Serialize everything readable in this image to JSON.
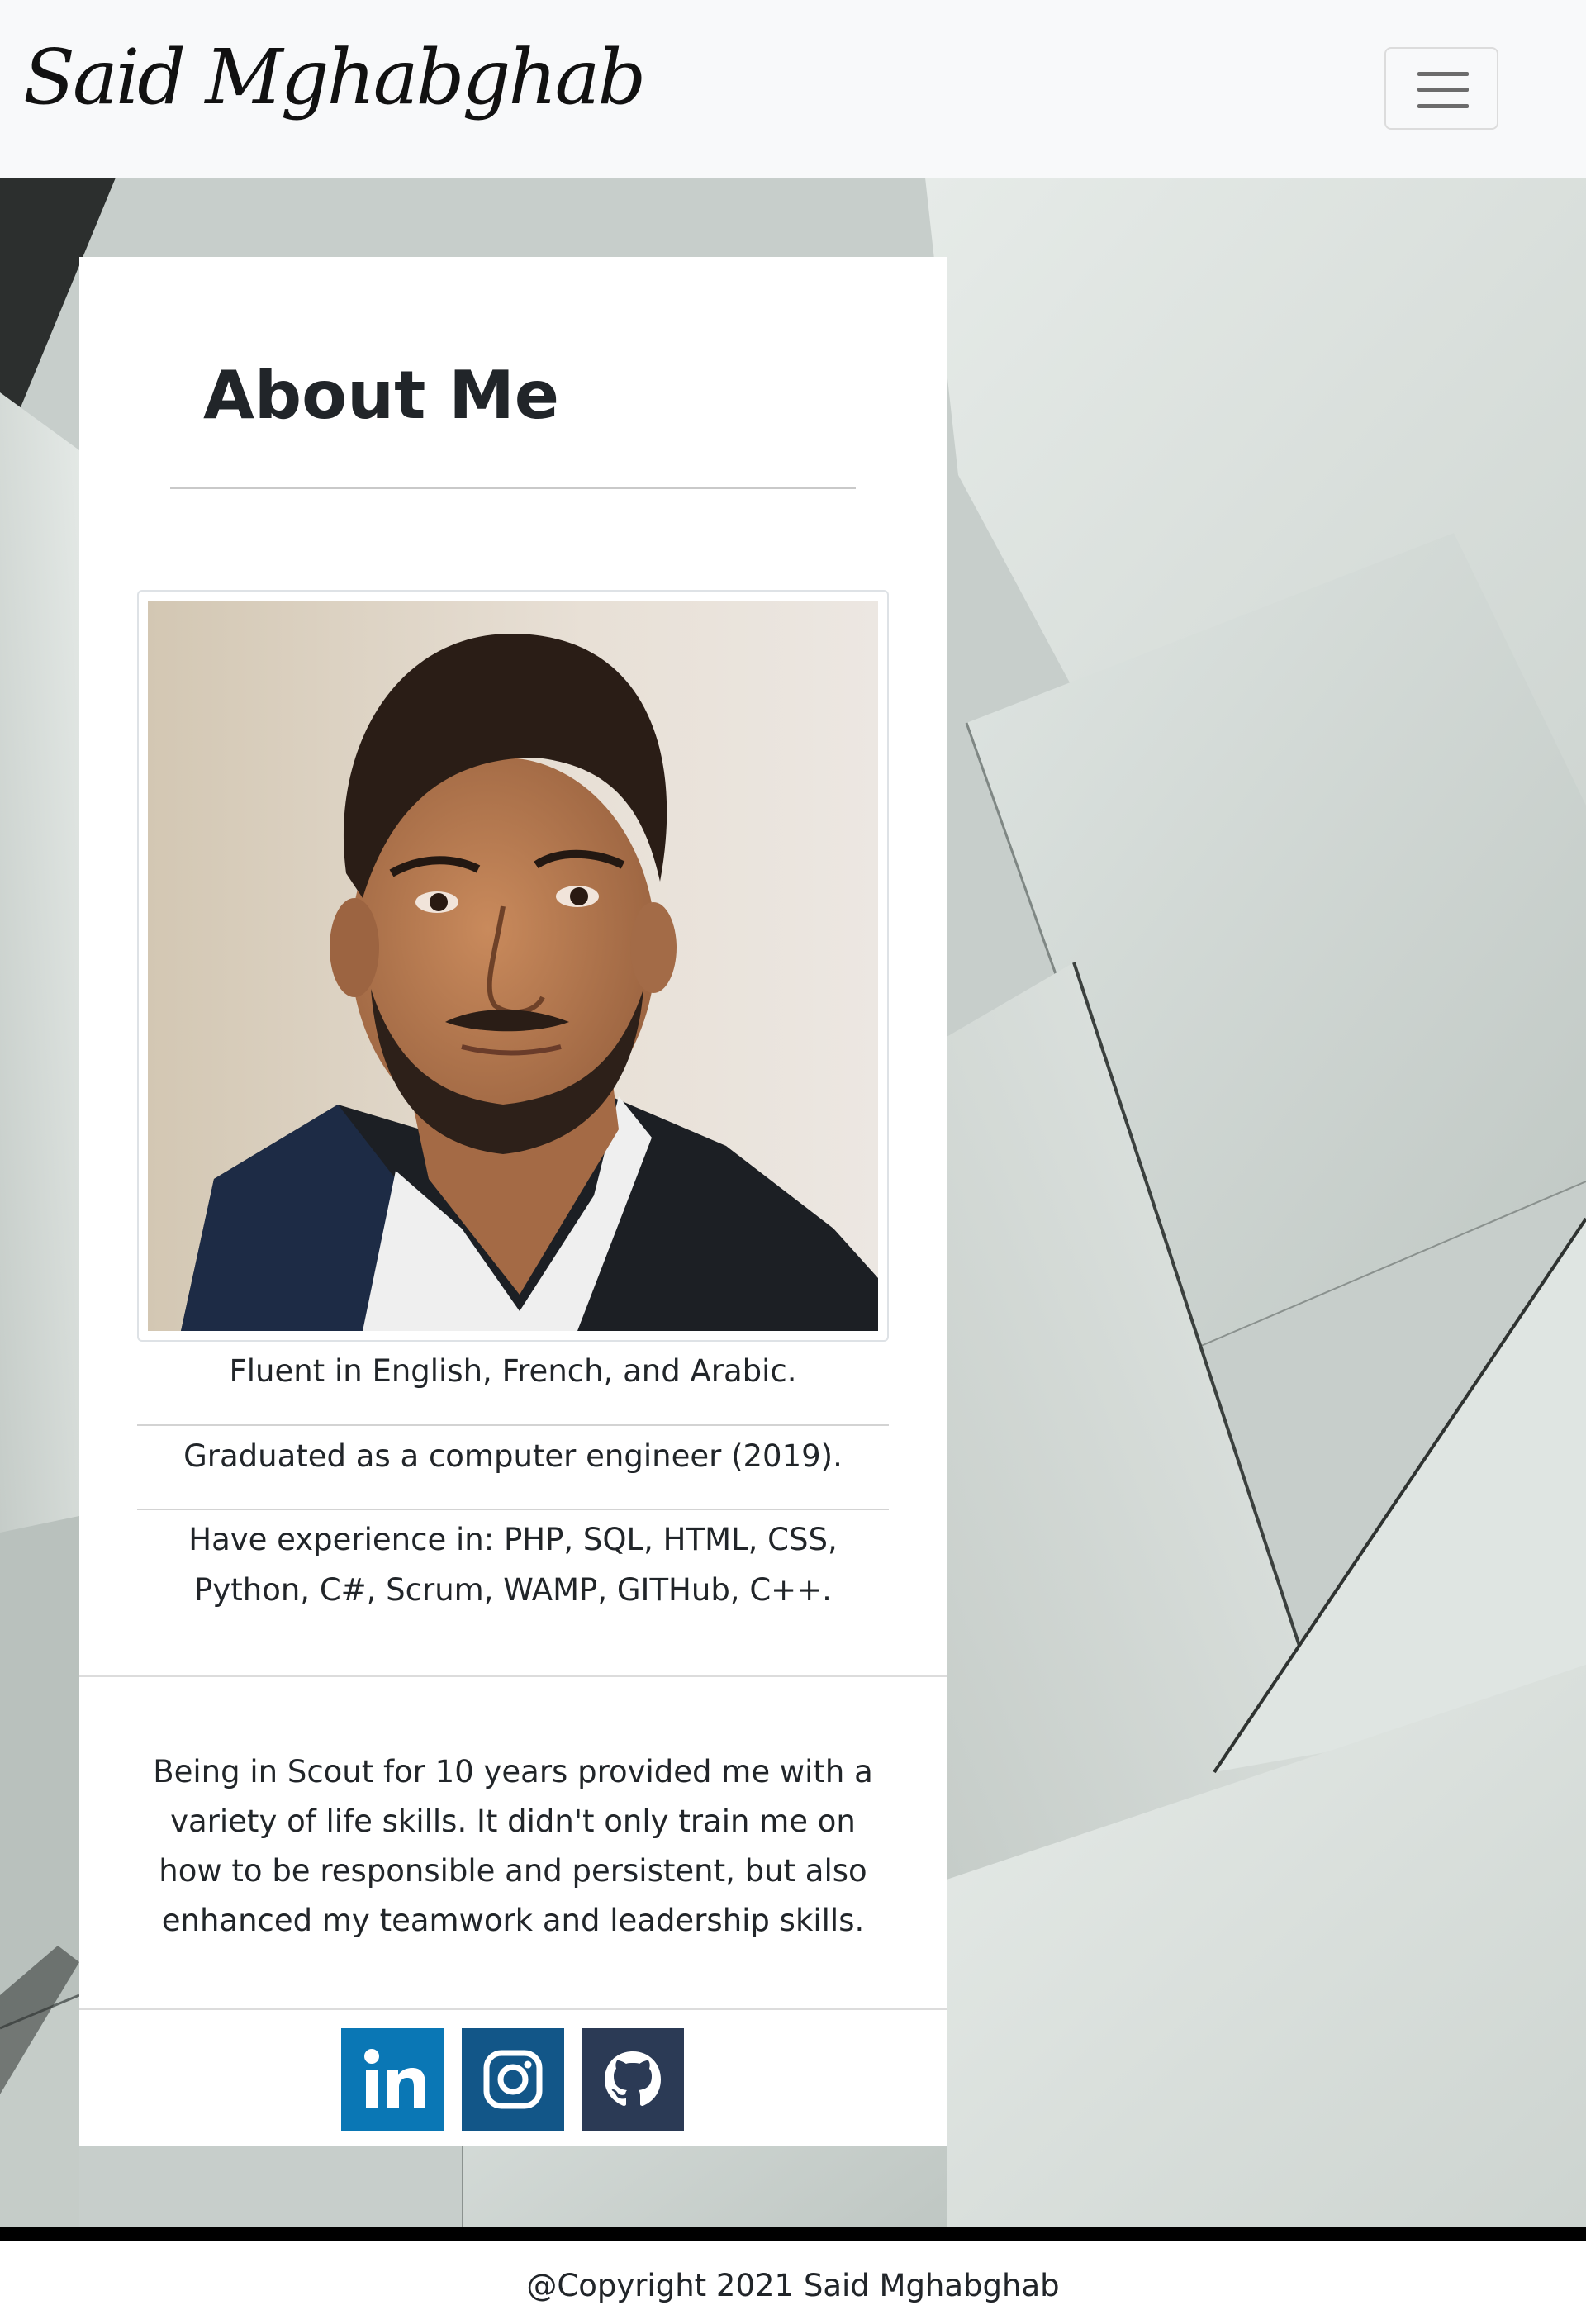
{
  "navbar": {
    "brand": "Said Mghabghab",
    "toggler_icon": "hamburger-menu-icon"
  },
  "about": {
    "title": "About Me",
    "photo_icon": "profile-photo",
    "facts": [
      "Fluent in English, French, and Arabic.",
      "Graduated as a computer engineer (2019).",
      "Have experience in: PHP, SQL, HTML, CSS, Python, C#, Scrum, WAMP, GITHub, C++."
    ],
    "scout": "Being in Scout for 10 years provided me with a variety of life skills. It didn't only train me on how to be responsible and persistent, but also enhanced my teamwork and leadership skills."
  },
  "social": [
    {
      "icon": "linkedin-icon",
      "color": "#0a77b5"
    },
    {
      "icon": "instagram-icon",
      "color": "#125688"
    },
    {
      "icon": "github-icon",
      "color": "#2b3a55"
    }
  ],
  "footer": {
    "copyright": "@Copyright 2021 Said Mghabghab"
  }
}
